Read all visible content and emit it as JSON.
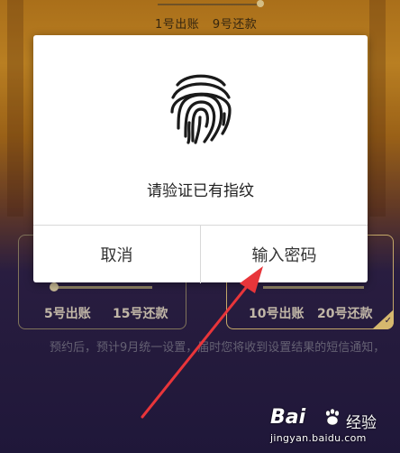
{
  "background_page": {
    "top_labels": [
      "1号出账",
      "9号还款"
    ],
    "cards": [
      {
        "bill_label": "5号出账",
        "repay_label": "15号还款",
        "selected": false
      },
      {
        "bill_label": "10号出账",
        "repay_label": "20号还款",
        "selected": true
      }
    ],
    "notice": "预约后，预计9月统一设置，届时您将收到设置结果的短信通知，"
  },
  "dialog": {
    "icon": "fingerprint-icon",
    "message": "请验证已有指纹",
    "cancel_label": "取消",
    "password_label": "输入密码"
  },
  "watermark": {
    "logo": "Bai",
    "brand": "经验",
    "url": "jingyan.baidu.com"
  },
  "colors": {
    "dialog_bg": "#ffffff",
    "annotation_arrow": "#e8353a",
    "selected_card_border": "#d6b772"
  }
}
